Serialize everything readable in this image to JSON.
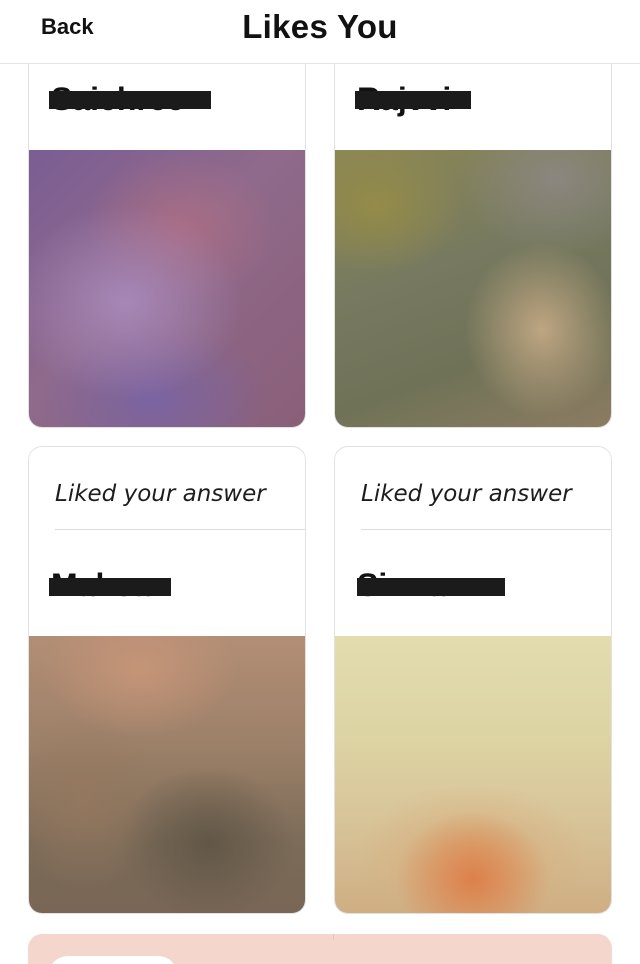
{
  "header": {
    "back_label": "Back",
    "title": "Likes You"
  },
  "cards": [
    {
      "name": "Saichree",
      "has_answer_label": false
    },
    {
      "name": "Rajvvi",
      "has_answer_label": false
    },
    {
      "answer_label": "Liked your answer",
      "name": "Mahsa"
    },
    {
      "answer_label": "Liked your answer",
      "name": "Simran"
    }
  ],
  "colors": {
    "promo_background": "#f4d6cc",
    "redaction": "#1b1b1b"
  }
}
